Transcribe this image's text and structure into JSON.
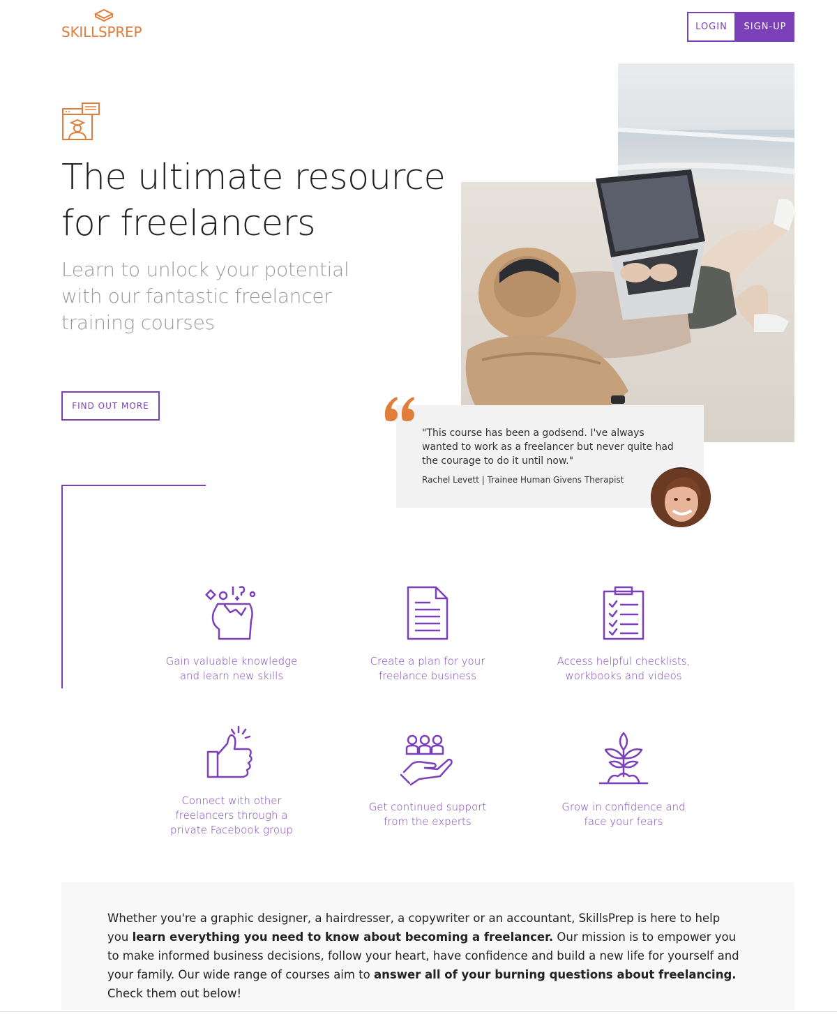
{
  "header": {
    "logo_text": "SKILLSPREP",
    "login_label": "LOGIN",
    "signup_label": "SIGN-UP"
  },
  "hero": {
    "title_line1": "The ultimate resource",
    "title_line2": "for freelancers",
    "subtitle_line1": "Learn to unlock your potential",
    "subtitle_line2": "with our fantastic freelancer",
    "subtitle_line3": "training courses",
    "cta_label": "FIND OUT MORE"
  },
  "testimonial": {
    "quote_line1": "\"This course has been a godsend. I've always",
    "quote_line2": "wanted to work as a freelancer but never quite had",
    "quote_line3": "the courage to do it until now.\"",
    "author": "Rachel Levett | Trainee Human Givens Therapist"
  },
  "features": [
    {
      "line1": "Gain valuable knowledge",
      "line2": "and learn new skills",
      "line3": "",
      "icon": "head-ideas-icon"
    },
    {
      "line1": "Create a plan for your",
      "line2": "freelance business",
      "line3": "",
      "icon": "document-icon"
    },
    {
      "line1": "Access helpful checklists,",
      "line2": "workbooks and videos",
      "line3": "",
      "icon": "checklist-icon"
    },
    {
      "line1": "Connect with other",
      "line2": "freelancers through a",
      "line3": "private Facebook group",
      "icon": "thumbs-up-icon"
    },
    {
      "line1": "Get continued support",
      "line2": "from the experts",
      "line3": "",
      "icon": "support-hand-icon"
    },
    {
      "line1": "Grow in confidence and",
      "line2": "face your fears",
      "line3": "",
      "icon": "plant-growth-icon"
    }
  ],
  "about": {
    "part1": "Whether you're a graphic designer, a hairdresser, a copywriter or an accountant, SkillsPrep is here to help you ",
    "bold1": "learn everything you need to know about becoming a freelancer.",
    "part2": " Our mission is to empower you to make informed business decisions, follow your heart, have confidence and build a new life for yourself and your family. Our wide range of courses aim to ",
    "bold2": "answer all of your burning questions about freelancing.",
    "part3": " Check them out below!"
  },
  "colors": {
    "brand_orange": "#e07d3a",
    "accent_purple": "#7b3fb8",
    "panel_gray": "#f2f2f2"
  }
}
